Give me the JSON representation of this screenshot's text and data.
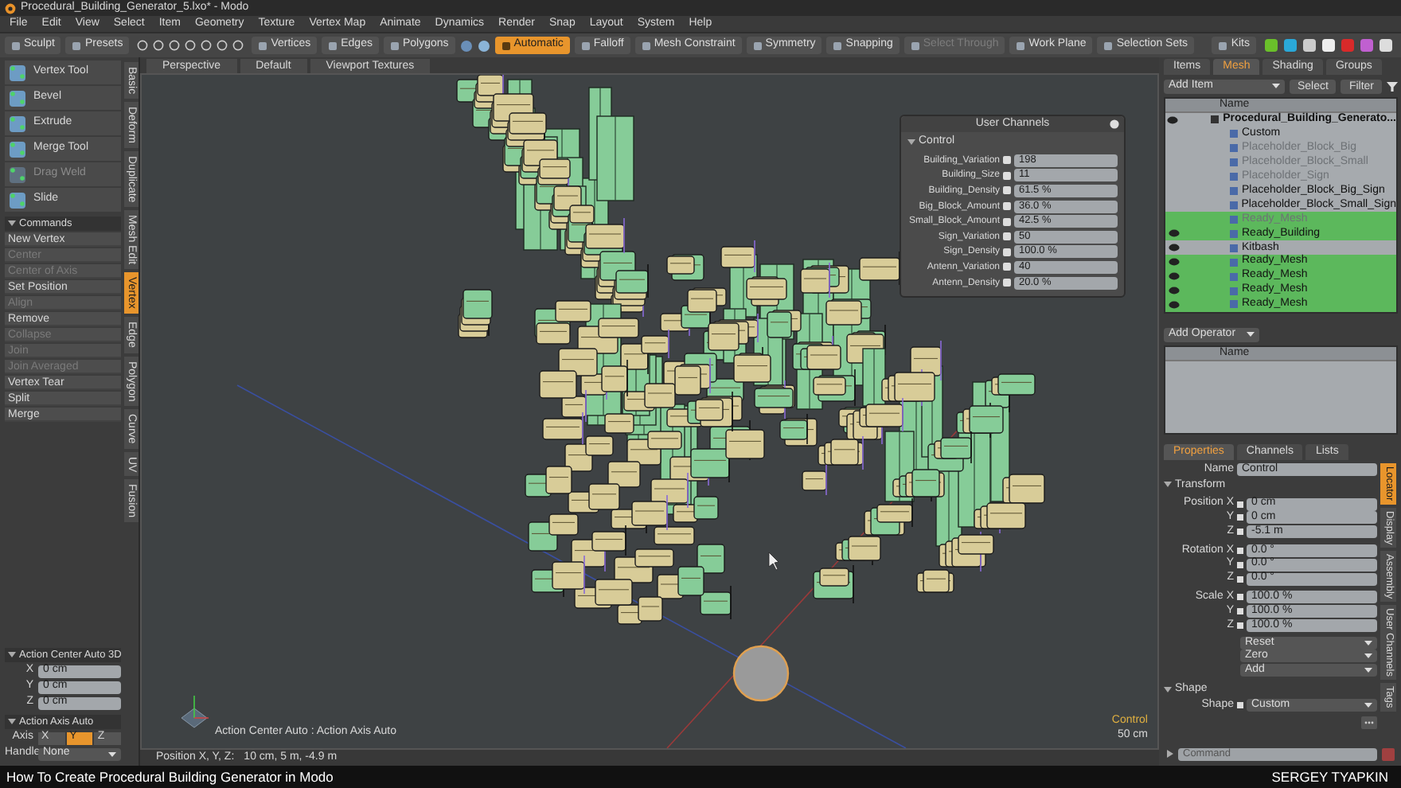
{
  "window": {
    "title": "Procedural_Building_Generator_5.lxo* - Modo"
  },
  "menu": [
    "File",
    "Edit",
    "View",
    "Select",
    "Item",
    "Geometry",
    "Texture",
    "Vertex Map",
    "Animate",
    "Dynamics",
    "Render",
    "Snap",
    "Layout",
    "System",
    "Help"
  ],
  "toolbar": [
    {
      "label": "Sculpt",
      "selected": false,
      "disabled": false
    },
    {
      "label": "Presets",
      "selected": false,
      "disabled": false
    },
    {
      "label": "Vertices",
      "selected": false,
      "disabled": false
    },
    {
      "label": "Edges",
      "selected": false,
      "disabled": false
    },
    {
      "label": "Polygons",
      "selected": false,
      "disabled": false
    },
    {
      "label": "Automatic",
      "selected": true,
      "disabled": false
    },
    {
      "label": "Falloff",
      "selected": false,
      "disabled": false
    },
    {
      "label": "Mesh Constraint",
      "selected": false,
      "disabled": false
    },
    {
      "label": "Symmetry",
      "selected": false,
      "disabled": false
    },
    {
      "label": "Snapping",
      "selected": false,
      "disabled": false
    },
    {
      "label": "Select Through",
      "selected": false,
      "disabled": true
    },
    {
      "label": "Work Plane",
      "selected": false,
      "disabled": false
    },
    {
      "label": "Selection Sets",
      "selected": false,
      "disabled": false
    },
    {
      "label": "Kits",
      "selected": false,
      "disabled": false
    }
  ],
  "left_panel": {
    "tools": [
      {
        "label": "Vertex Tool",
        "disabled": false
      },
      {
        "label": "Bevel",
        "disabled": false
      },
      {
        "label": "Extrude",
        "disabled": false
      },
      {
        "label": "Merge Tool",
        "disabled": false
      },
      {
        "label": "Drag Weld",
        "disabled": true
      },
      {
        "label": "Slide",
        "disabled": false
      }
    ],
    "commands_title": "Commands",
    "commands": [
      {
        "label": "New Vertex",
        "disabled": false
      },
      {
        "label": "Center",
        "disabled": true
      },
      {
        "label": "Center of Axis",
        "disabled": true
      },
      {
        "label": "Set Position",
        "disabled": false
      },
      {
        "label": "Align",
        "disabled": true
      },
      {
        "label": "Remove",
        "disabled": false
      },
      {
        "label": "Collapse",
        "disabled": true
      },
      {
        "label": "Join",
        "disabled": true
      },
      {
        "label": "Join Averaged",
        "disabled": true
      },
      {
        "label": "Vertex Tear",
        "disabled": false
      },
      {
        "label": "Split",
        "disabled": false
      },
      {
        "label": "Merge",
        "disabled": false
      }
    ],
    "tabs": [
      {
        "label": "Basic",
        "selected": false
      },
      {
        "label": "Deform",
        "selected": false
      },
      {
        "label": "Duplicate",
        "selected": false
      },
      {
        "label": "Mesh Edit",
        "selected": false
      },
      {
        "label": "Vertex",
        "selected": true
      },
      {
        "label": "Edge",
        "selected": false
      },
      {
        "label": "Polygon",
        "selected": false
      },
      {
        "label": "Curve",
        "selected": false
      },
      {
        "label": "UV",
        "selected": false
      },
      {
        "label": "Fusion",
        "selected": false
      }
    ],
    "action_center": {
      "title": "Action Center Auto 3D",
      "fields": [
        {
          "label": "X",
          "value": "0 cm"
        },
        {
          "label": "Y",
          "value": "0 cm"
        },
        {
          "label": "Z",
          "value": "0 cm"
        }
      ]
    },
    "action_axis": {
      "title": "Action Axis Auto",
      "axis_label": "Axis",
      "axes": [
        {
          "label": "X",
          "selected": false
        },
        {
          "label": "Y",
          "selected": true
        },
        {
          "label": "Z",
          "selected": false
        }
      ],
      "handle_label": "Handle",
      "handle_value": "None"
    }
  },
  "viewport": {
    "tabs": [
      "Perspective",
      "Default",
      "Viewport Textures"
    ],
    "overlay_label": "Action Center Auto : Action Axis Auto",
    "item_label": "Control",
    "scale": "50 cm",
    "status_label": "Position X, Y, Z:",
    "status_value": "10 cm, 5 m, -4.9 m"
  },
  "user_channels": {
    "title": "User Channels",
    "group": "Control",
    "channels": [
      {
        "name": "Building_Variation",
        "value": "198"
      },
      {
        "name": "Building_Size",
        "value": "11"
      },
      {
        "name": "Building_Density",
        "value": "61.5 %"
      },
      {
        "name": "Big_Block_Amount",
        "value": "36.0 %"
      },
      {
        "name": "Small_Block_Amount",
        "value": "42.5 %"
      },
      {
        "name": "Sign_Variation",
        "value": "50"
      },
      {
        "name": "Sign_Density",
        "value": "100.0 %"
      },
      {
        "name": "Antenn_Variation",
        "value": "40"
      },
      {
        "name": "Antenn_Density",
        "value": "20.0 %"
      }
    ]
  },
  "items_panel": {
    "tabs": [
      {
        "label": "Items",
        "selected": false
      },
      {
        "label": "Mesh",
        "selected": true
      },
      {
        "label": "Shading",
        "selected": false
      },
      {
        "label": "Groups",
        "selected": false
      }
    ],
    "add_item": "Add Item",
    "buttons": [
      "Select",
      "Filter"
    ],
    "column": "Name",
    "tree": [
      {
        "label": "Procedural_Building_Generato...",
        "visible": true,
        "dimmed": false,
        "highlighted": false,
        "children": [
          {
            "label": "Custom",
            "visible": false,
            "dimmed": false,
            "highlighted": false
          },
          {
            "label": "Placeholder_Block_Big",
            "visible": false,
            "dimmed": true,
            "highlighted": false
          },
          {
            "label": "Placeholder_Block_Small",
            "visible": false,
            "dimmed": true,
            "highlighted": false
          },
          {
            "label": "Placeholder_Sign",
            "visible": false,
            "dimmed": true,
            "highlighted": false
          },
          {
            "label": "Placeholder_Block_Big_Sign",
            "visible": false,
            "dimmed": false,
            "highlighted": false
          },
          {
            "label": "Placeholder_Block_Small_Sign",
            "visible": false,
            "dimmed": false,
            "highlighted": false
          },
          {
            "label": "Ready_Mesh",
            "visible": false,
            "dimmed": true,
            "highlighted": true
          },
          {
            "label": "Ready_Building",
            "visible": true,
            "dimmed": false,
            "highlighted": true
          },
          {
            "label": "Kitbash",
            "visible": true,
            "dimmed": false,
            "highlighted": false
          },
          {
            "label": "Ready_Mesh",
            "visible": true,
            "dimmed": false,
            "highlighted": true
          },
          {
            "label": "Ready_Mesh",
            "visible": true,
            "dimmed": false,
            "highlighted": true
          },
          {
            "label": "Ready_Mesh",
            "visible": true,
            "dimmed": false,
            "highlighted": true
          },
          {
            "label": "Ready_Mesh",
            "visible": true,
            "dimmed": false,
            "highlighted": true
          }
        ]
      }
    ]
  },
  "operator_panel": {
    "add_operator": "Add Operator",
    "column": "Name"
  },
  "properties": {
    "tabs": [
      {
        "label": "Properties",
        "selected": true
      },
      {
        "label": "Channels",
        "selected": false
      },
      {
        "label": "Lists",
        "selected": false
      }
    ],
    "name_label": "Name",
    "name_value": "Control",
    "section": "Transform",
    "groups": [
      {
        "rows": [
          {
            "label": "Position X",
            "value": "0 cm"
          },
          {
            "label": "Y",
            "value": "0 cm"
          },
          {
            "label": "Z",
            "value": "-5.1 m"
          }
        ]
      },
      {
        "rows": [
          {
            "label": "Rotation X",
            "value": "0.0 °"
          },
          {
            "label": "Y",
            "value": "0.0 °"
          },
          {
            "label": "Z",
            "value": "0.0 °"
          }
        ]
      },
      {
        "rows": [
          {
            "label": "Scale X",
            "value": "100.0 %"
          },
          {
            "label": "Y",
            "value": "100.0 %"
          },
          {
            "label": "Z",
            "value": "100.0 %"
          }
        ]
      }
    ],
    "actions": [
      "Reset",
      "Zero",
      "Add"
    ],
    "shape_section": "Shape",
    "shape_label": "Shape",
    "shape_value": "Custom",
    "side_tabs": [
      {
        "label": "Locator",
        "selected": true
      },
      {
        "label": "Display",
        "selected": false
      },
      {
        "label": "Assembly",
        "selected": false
      },
      {
        "label": "User Channels",
        "selected": false
      },
      {
        "label": "Tags",
        "selected": false
      }
    ],
    "command_placeholder": "Command"
  },
  "caption": {
    "title": "How To Create Procedural Building Generator in Modo",
    "author": "SERGEY TYAPKIN"
  }
}
